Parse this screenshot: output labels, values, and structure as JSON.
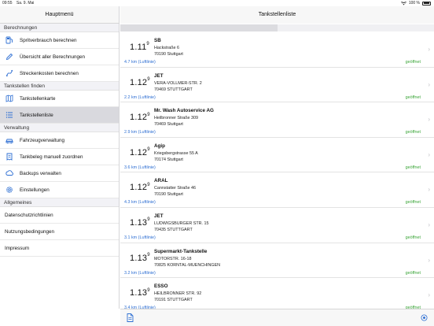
{
  "statusbar": {
    "time": "09:55",
    "date": "Sa. 9. Mai",
    "battery": "100 %"
  },
  "sidebar": {
    "title": "Hauptmenü",
    "sections": {
      "berechnungen": "Berechnungen",
      "tankstellen": "Tankstellen finden",
      "verwaltung": "Verwaltung",
      "allgemeines": "Allgemeines"
    },
    "items": [
      {
        "label": "Spritverbrauch berechnen",
        "icon": "fuel-consumption-icon"
      },
      {
        "label": "Übersicht aller Berechnungen",
        "icon": "pen-icon"
      },
      {
        "label": "Streckenkosten berechnen",
        "icon": "route-icon"
      },
      {
        "label": "Tankstellenkarte",
        "icon": "map-icon"
      },
      {
        "label": "Tankstellenliste",
        "icon": "list-icon",
        "selected": true
      },
      {
        "label": "Fahrzeugverwaltung",
        "icon": "car-icon"
      },
      {
        "label": "Tankbeleg manuell zuordnen",
        "icon": "receipt-icon"
      },
      {
        "label": "Backups verwalten",
        "icon": "backup-icon"
      },
      {
        "label": "Einstellungen",
        "icon": "gear-icon"
      }
    ],
    "general": [
      "Datenschutzrichtlinien",
      "Nutzungsbedingungen",
      "Impressum"
    ]
  },
  "main": {
    "title": "Tankstellenliste",
    "progress": 0.5,
    "stations": [
      {
        "price": "1.11",
        "price_sup": "9",
        "brand": "SB",
        "street": "Hackstraße 6",
        "city": "70190 Stuttgart",
        "distance": "4.7 km (Luftlinie)",
        "status": "geöffnet"
      },
      {
        "price": "1.12",
        "price_sup": "9",
        "brand": "JET",
        "street": "VERA-VOLLMER-STR. 2",
        "city": "70469 STUTTGART",
        "distance": "2.2 km (Luftlinie)",
        "status": "geöffnet"
      },
      {
        "price": "1.12",
        "price_sup": "9",
        "brand": "Mr. Wash Autoservice AG",
        "street": "Heilbronner Straße 309",
        "city": "70469 Stuttgart",
        "distance": "2.9 km (Luftlinie)",
        "status": "geöffnet"
      },
      {
        "price": "1.12",
        "price_sup": "9",
        "brand": "Agip",
        "street": "Kriegsbergstrasse 55 A",
        "city": "70174 Stuttgart",
        "distance": "3.6 km (Luftlinie)",
        "status": "geöffnet"
      },
      {
        "price": "1.12",
        "price_sup": "9",
        "brand": "ARAL",
        "street": "Cannstatter Straße 46",
        "city": "70190 Stuttgart",
        "distance": "4.3 km (Luftlinie)",
        "status": "geöffnet"
      },
      {
        "price": "1.13",
        "price_sup": "9",
        "brand": "JET",
        "street": "LUDWIGSBURGER STR. 15",
        "city": "70435 STUTTGART",
        "distance": "3.1 km (Luftlinie)",
        "status": "geöffnet"
      },
      {
        "price": "1.13",
        "price_sup": "9",
        "brand": "Supermarkt-Tankstelle",
        "street": "MOTORSTR. 16-18",
        "city": "70825 KORNTAL-MUENCHINGEN",
        "distance": "3.2 km (Luftlinie)",
        "status": "geöffnet"
      },
      {
        "price": "1.13",
        "price_sup": "9",
        "brand": "ESSO",
        "street": "HEILBRONNER STR. 92",
        "city": "70191 STUTTGART",
        "distance": "3.4 km (Luftlinie)",
        "status": "geöffnet"
      }
    ]
  },
  "colors": {
    "accent": "#2e6fd3",
    "open": "#3da63a",
    "selected_bg": "#d9d9de"
  }
}
